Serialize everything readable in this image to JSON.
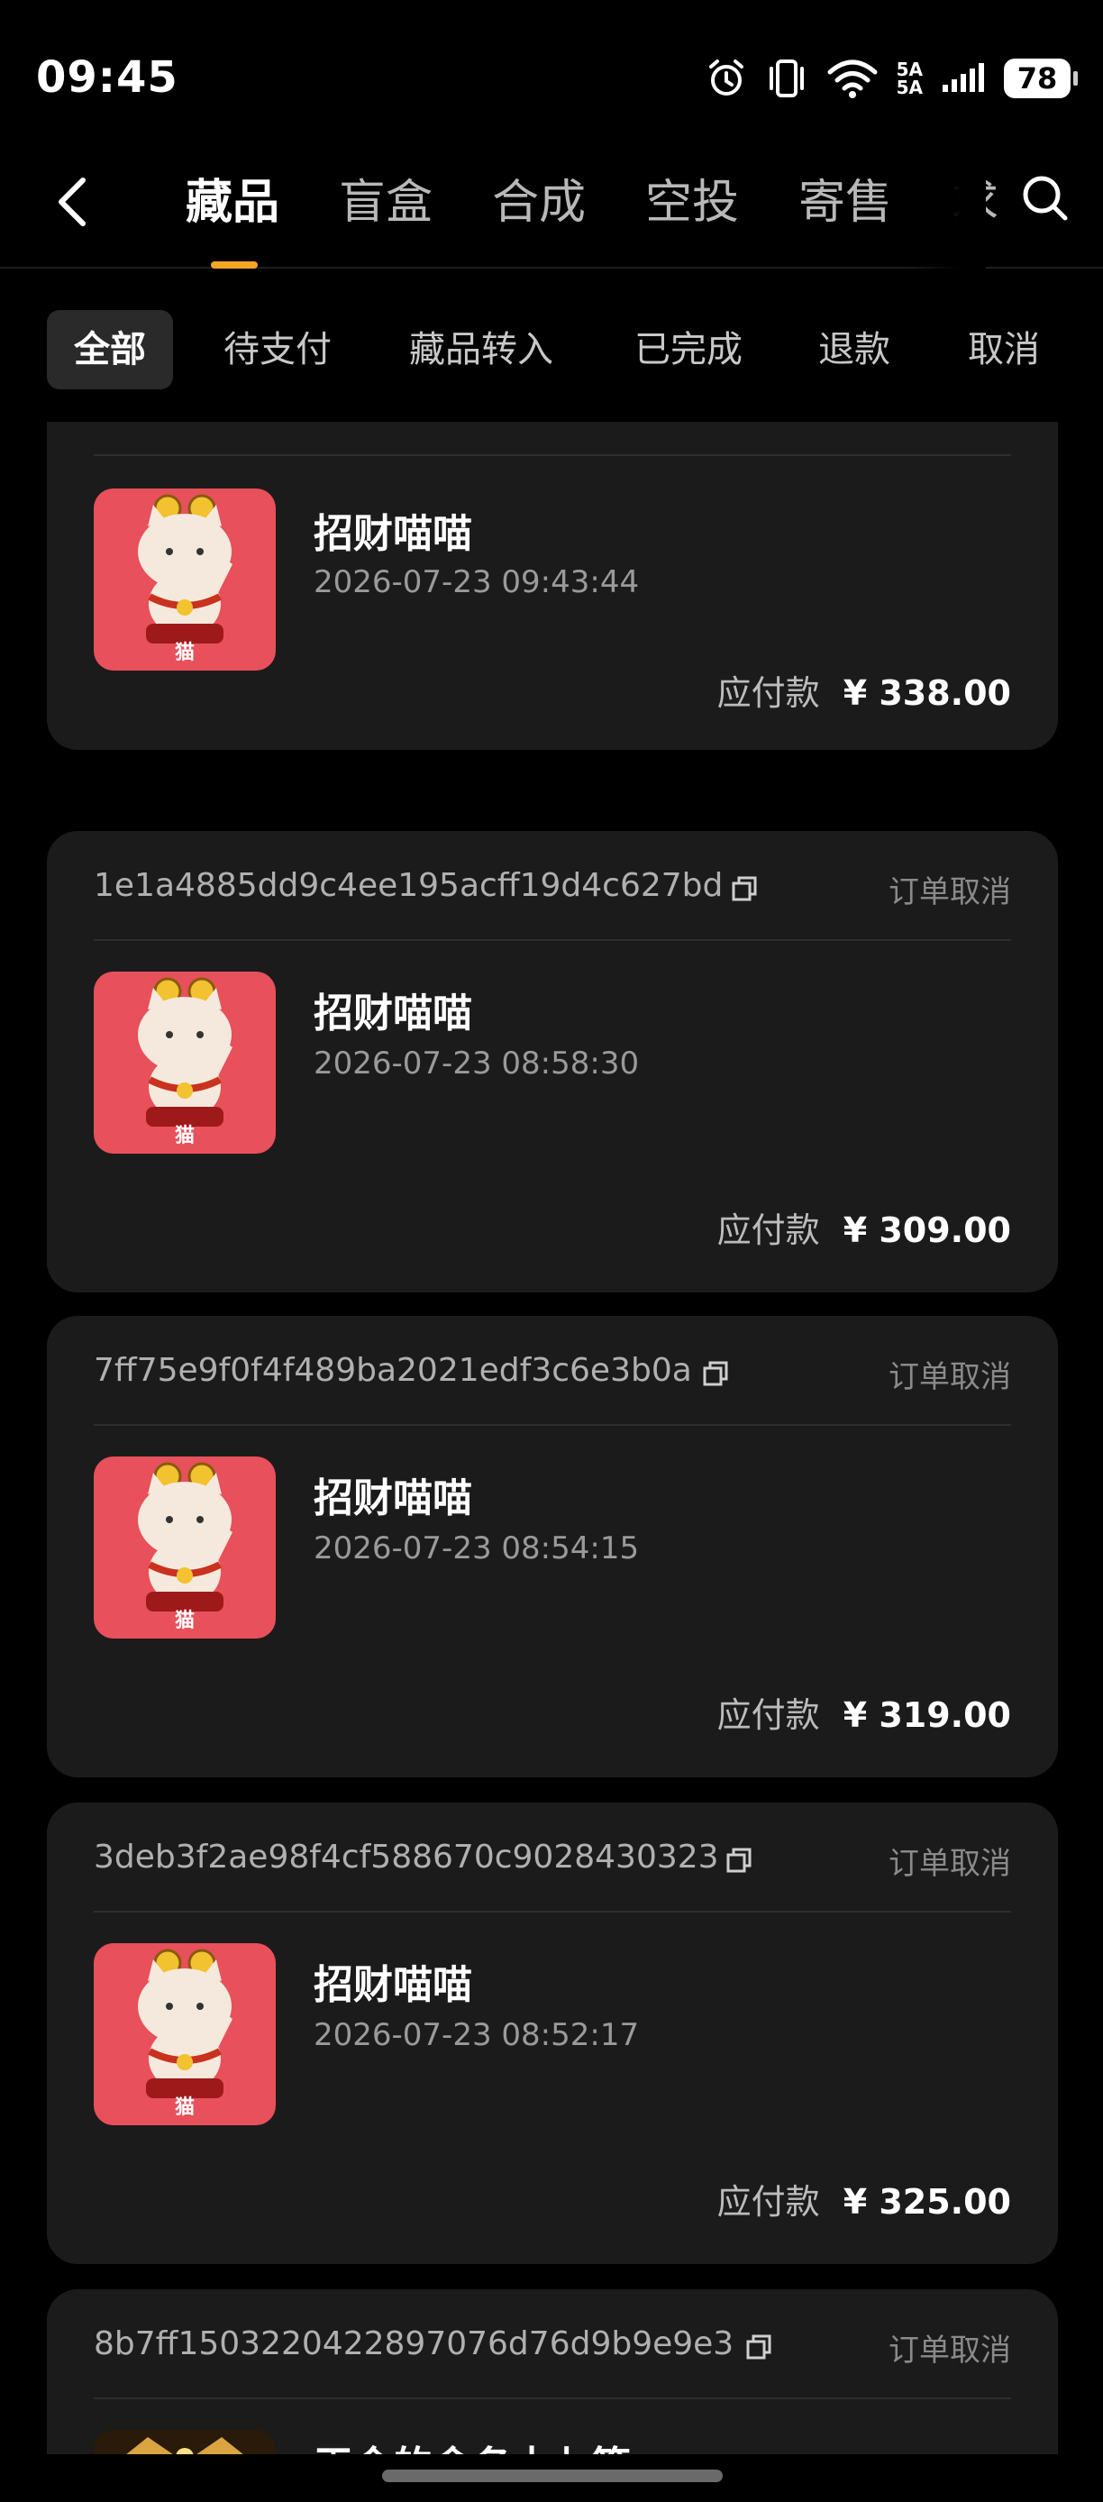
{
  "status_bar": {
    "time": "09:45",
    "network_top": "5A",
    "network_bottom": "5A",
    "battery": "78"
  },
  "nav": {
    "tabs": [
      {
        "label": "藏品",
        "active": true
      },
      {
        "label": "盲盒",
        "active": false
      },
      {
        "label": "合成",
        "active": false
      },
      {
        "label": "空投",
        "active": false
      },
      {
        "label": "寄售",
        "active": false
      },
      {
        "label": "求",
        "active": false
      }
    ],
    "accent_color": "#f5a623"
  },
  "filters": [
    {
      "label": "全部",
      "active": true
    },
    {
      "label": "待支付",
      "active": false
    },
    {
      "label": "藏品转入",
      "active": false
    },
    {
      "label": "已完成",
      "active": false
    },
    {
      "label": "退款",
      "active": false
    },
    {
      "label": "取消",
      "active": false
    }
  ],
  "orders": [
    {
      "id": "",
      "status": "",
      "item_name": "招财喵喵",
      "thumb_label": "猫",
      "time": "2026-07-23 09:43:44",
      "pay_label": "应付款",
      "amount": "¥ 338.00"
    },
    {
      "id": "1e1a4885dd9c4ee195acff19d4c627bd",
      "status": "订单取消",
      "item_name": "招财喵喵",
      "thumb_label": "猫",
      "time": "2026-07-23 08:58:30",
      "pay_label": "应付款",
      "amount": "¥ 309.00"
    },
    {
      "id": "7ff75e9f0f4f489ba2021edf3c6e3b0a",
      "status": "订单取消",
      "item_name": "招财喵喵",
      "thumb_label": "猫",
      "time": "2026-07-23 08:54:15",
      "pay_label": "应付款",
      "amount": "¥ 319.00"
    },
    {
      "id": "3deb3f2ae98f4cf588670c9028430323",
      "status": "订单取消",
      "item_name": "招财喵喵",
      "thumb_label": "猫",
      "time": "2026-07-23 08:52:17",
      "pay_label": "应付款",
      "amount": "¥ 325.00"
    },
    {
      "id": "8b7ff1503220422897076d76d9b9e9e3",
      "status": "订单取消",
      "item_name": "王金的舍名十七等",
      "thumb_label": "",
      "time": "",
      "pay_label": "",
      "amount": ""
    }
  ]
}
